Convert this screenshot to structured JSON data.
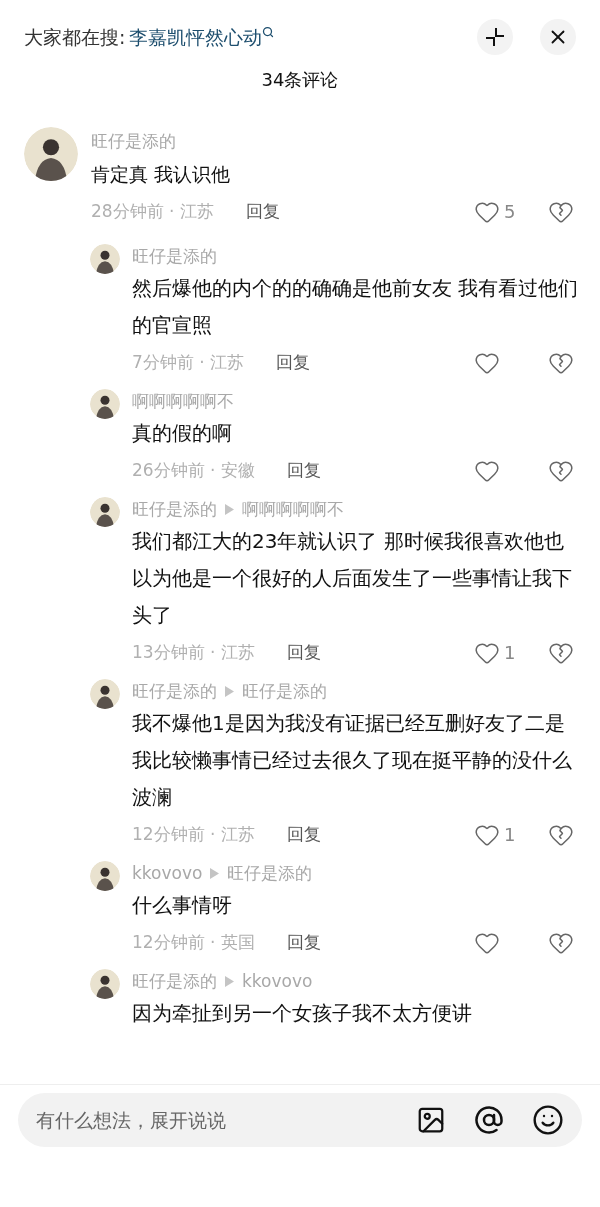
{
  "search_bar": {
    "label": "大家都在搜:",
    "query": "李嘉凯怦然心动"
  },
  "comment_count": "34条评论",
  "comments": [
    {
      "user": "旺仔是添的",
      "text": "肯定真 我认识他",
      "time": "28分钟前 · 江苏",
      "reply": "回复",
      "likes": "5",
      "replies": [
        {
          "user": "旺仔是添的",
          "text": "然后爆他的内个的的确确是他前女友 我有看过他们的官宣照",
          "time": "7分钟前 · 江苏",
          "reply": "回复"
        },
        {
          "user": "啊啊啊啊啊不",
          "text": "真的假的啊",
          "time": "26分钟前 · 安徽",
          "reply": "回复"
        },
        {
          "user": "旺仔是添的",
          "reply_to": "啊啊啊啊啊不",
          "text": "我们都江大的23年就认识了 那时候我很喜欢他也以为他是一个很好的人后面发生了一些事情让我下头了",
          "time": "13分钟前 · 江苏",
          "reply": "回复",
          "likes": "1"
        },
        {
          "user": "旺仔是添的",
          "reply_to": "旺仔是添的",
          "text": "我不爆他1是因为我没有证据已经互删好友了二是我比较懒事情已经过去很久了现在挺平静的没什么波澜",
          "time": "12分钟前 · 江苏",
          "reply": "回复",
          "likes": "1"
        },
        {
          "user": "kkovovo",
          "reply_to": "旺仔是添的",
          "text": "什么事情呀",
          "time": "12分钟前 · 英国",
          "reply": "回复"
        },
        {
          "user": "旺仔是添的",
          "reply_to": "kkovovo",
          "text": "因为牵扯到另一个女孩子我不太方便讲"
        }
      ]
    }
  ],
  "input": {
    "placeholder": "有什么想法，展开说说"
  }
}
